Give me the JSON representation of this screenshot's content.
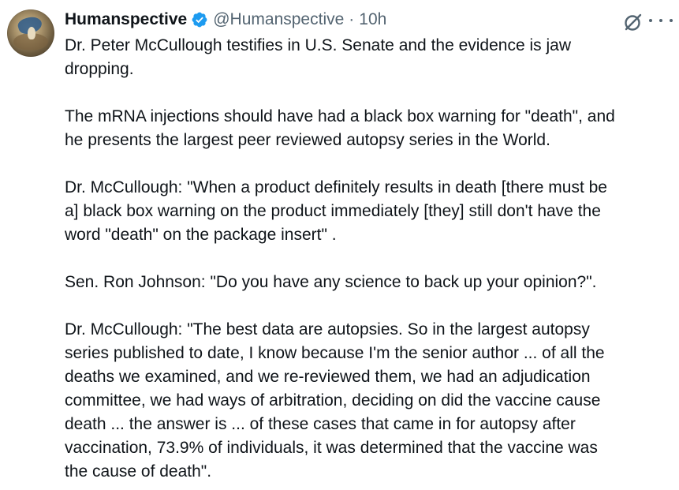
{
  "tweet": {
    "author": {
      "display_name": "Humanspective",
      "handle": "@Humanspective",
      "verified": true,
      "verified_color": "#1d9bf0",
      "avatar_icon": "avatar-image"
    },
    "separator": "·",
    "timestamp": "10h",
    "actions": {
      "grok_icon": "grok-icon",
      "more_icon": "more-options-icon"
    },
    "paragraphs": [
      "Dr. Peter McCullough testifies in U.S. Senate and the evidence is jaw\ndropping.",
      "The mRNA injections should have had a black box warning for \"death\", and\nhe presents the largest peer reviewed autopsy series in the World.",
      "Dr. McCullough: \"When a product definitely results in death [there must be\na] black box warning on the product immediately [they] still don't have the\nword \"death\" on the package insert\" .",
      "Sen. Ron Johnson: \"Do you have any science to back up your opinion?\".",
      "Dr. McCullough: \"The best data are autopsies. So in the largest autopsy\nseries published to date, I know because I'm the senior author ... of all the\ndeaths we examined, and we re-reviewed them, we had an adjudication\ncommittee, we had ways of arbitration, deciding on did the vaccine cause\ndeath ... the answer is ... of these cases that came in for autopsy after\nvaccination, 73.9% of individuals, it was determined that the vaccine was\nthe cause of death\"."
    ]
  }
}
